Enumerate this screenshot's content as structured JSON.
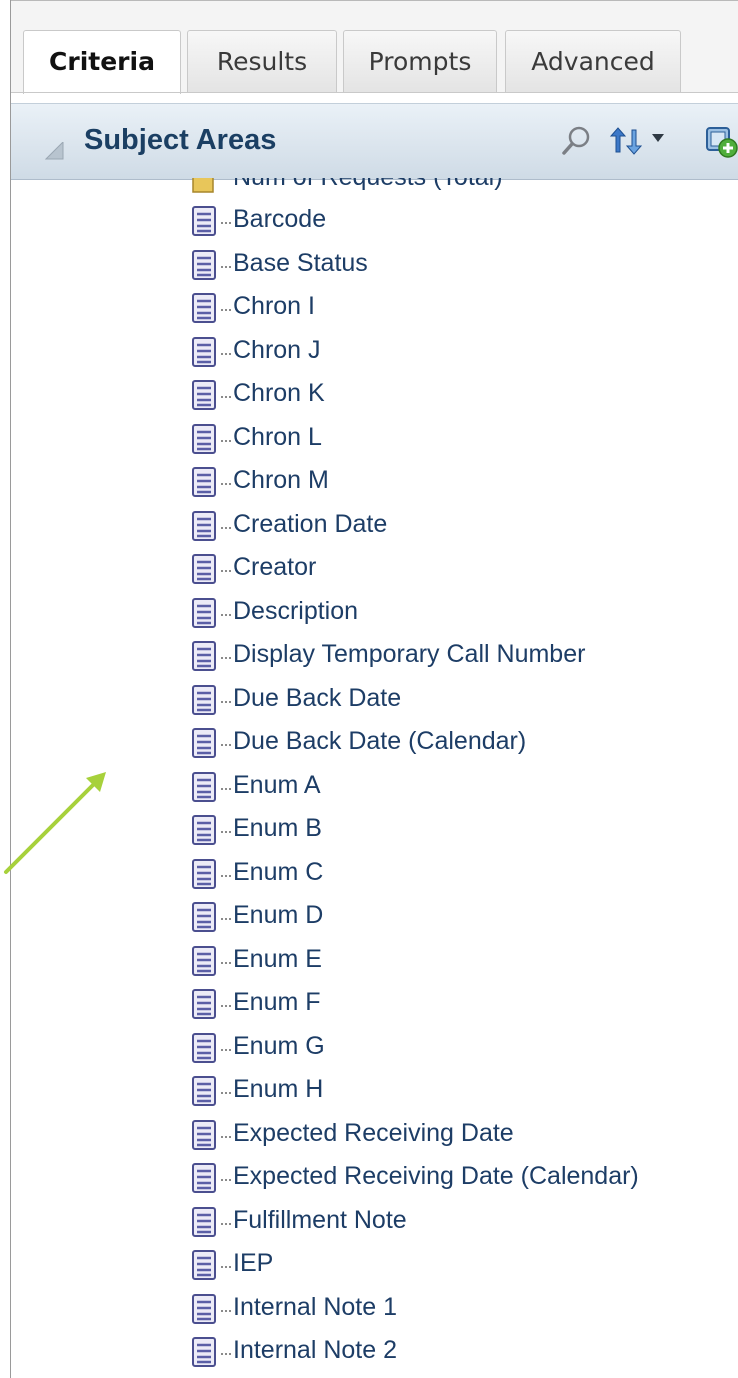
{
  "tabs": [
    {
      "label": "Criteria",
      "active": true
    },
    {
      "label": "Results",
      "active": false
    },
    {
      "label": "Prompts",
      "active": false
    },
    {
      "label": "Advanced",
      "active": false
    }
  ],
  "panel": {
    "title": "Subject Areas",
    "icons": [
      "search-icon",
      "sort-icon",
      "dropdown-arrow-icon",
      "add-subject-area-icon"
    ]
  },
  "tree": {
    "partial_item": "Num of Requests (Total)",
    "items": [
      "Barcode",
      "Base Status",
      "Chron I",
      "Chron J",
      "Chron K",
      "Chron L",
      "Chron M",
      "Creation Date",
      "Creator",
      "Description",
      "Display Temporary Call Number",
      "Due Back Date",
      "Due Back Date (Calendar)",
      "Enum A",
      "Enum B",
      "Enum C",
      "Enum D",
      "Enum E",
      "Enum F",
      "Enum G",
      "Enum H",
      "Expected Receiving Date",
      "Expected Receiving Date (Calendar)",
      "Fulfillment Note",
      "IEP",
      "Internal Note 1",
      "Internal Note 2"
    ]
  },
  "colors": {
    "arrow": "#a7d13b",
    "item_text": "#1d3d66",
    "header_text": "#1b3f63"
  }
}
